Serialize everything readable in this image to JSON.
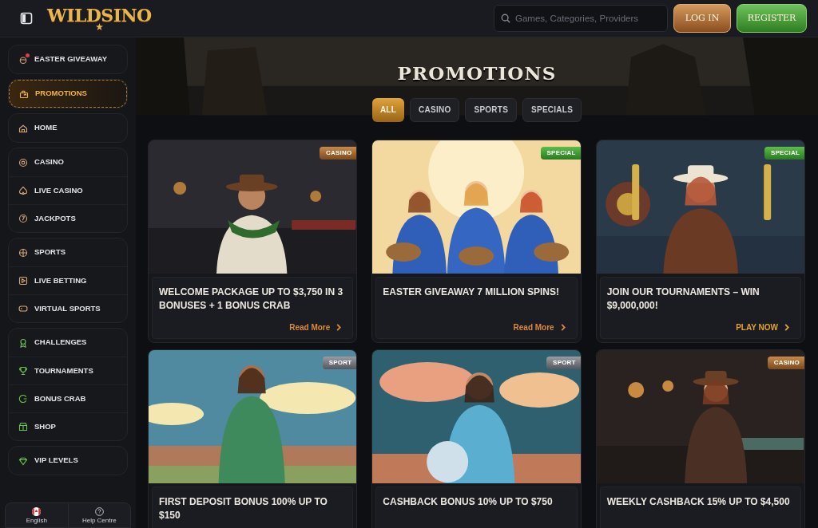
{
  "header": {
    "logo": "WILDSINO",
    "search": {
      "placeholder": "Games, Categories, Providers"
    },
    "buttons": [
      {
        "label": "LOG IN",
        "kind": "login"
      },
      {
        "label": "REGISTER",
        "kind": "register"
      }
    ]
  },
  "sidebar": {
    "groups": [
      {
        "items": [
          {
            "label": "EASTER GIVEAWAY",
            "selected": false,
            "notification": true
          }
        ]
      },
      {
        "items": [
          {
            "label": "PROMOTIONS",
            "selected": true,
            "notification": false
          }
        ]
      },
      {
        "items": [
          {
            "label": "HOME",
            "selected": false,
            "notification": false
          }
        ]
      },
      {
        "items": [
          {
            "label": "CASINO",
            "selected": false,
            "notification": false
          },
          {
            "label": "LIVE CASINO",
            "selected": false,
            "notification": false
          },
          {
            "label": "JACKPOTS",
            "selected": false,
            "notification": false
          }
        ]
      },
      {
        "items": [
          {
            "label": "SPORTS",
            "selected": false,
            "notification": false
          },
          {
            "label": "LIVE BETTING",
            "selected": false,
            "notification": false
          },
          {
            "label": "VIRTUAL SPORTS",
            "selected": false,
            "notification": false
          }
        ]
      },
      {
        "items": [
          {
            "label": "CHALLENGES",
            "selected": false,
            "notification": false
          },
          {
            "label": "TOURNAMENTS",
            "selected": false,
            "notification": false
          },
          {
            "label": "BONUS CRAB",
            "selected": false,
            "notification": false
          },
          {
            "label": "SHOP",
            "selected": false,
            "notification": false
          }
        ]
      },
      {
        "items": [
          {
            "label": "VIP LEVELS",
            "selected": false,
            "notification": false
          }
        ]
      }
    ],
    "footer": [
      {
        "label": "English"
      },
      {
        "label": "Help Centre"
      }
    ]
  },
  "page_title": "PROMOTIONS",
  "filters": [
    {
      "label": "ALL",
      "selected": true
    },
    {
      "label": "CASINO",
      "selected": false
    },
    {
      "label": "SPORTS",
      "selected": false
    },
    {
      "label": "SPECIALS",
      "selected": false
    }
  ],
  "cards": [
    {
      "tag": {
        "label": "CASINO",
        "kind": "casino"
      },
      "title": "WELCOME PACKAGE UP TO $3,750 IN 3 BONUSES + 1 BONUS CRAB",
      "link": {
        "label": "Read More",
        "kind": "read"
      }
    },
    {
      "tag": {
        "label": "SPECIAL",
        "kind": "special"
      },
      "title": "EASTER GIVEAWAY 7 MILLION SPINS!",
      "link": {
        "label": "Read More",
        "kind": "read"
      }
    },
    {
      "tag": {
        "label": "SPECIAL",
        "kind": "special"
      },
      "title": "JOIN OUR TOURNAMENTS – WIN $9,000,000!",
      "link": {
        "label": "PLAY NOW",
        "kind": "play"
      }
    },
    {
      "tag": {
        "label": "SPORT",
        "kind": "sport"
      },
      "title": "FIRST DEPOSIT BONUS 100% UP TO $150"
    },
    {
      "tag": {
        "label": "SPORT",
        "kind": "sport"
      },
      "title": "CASHBACK BONUS 10% UP TO $750"
    },
    {
      "tag": {
        "label": "CASINO",
        "kind": "casino"
      },
      "title": "WEEKLY CASHBACK 15% UP TO $4,500"
    }
  ]
}
